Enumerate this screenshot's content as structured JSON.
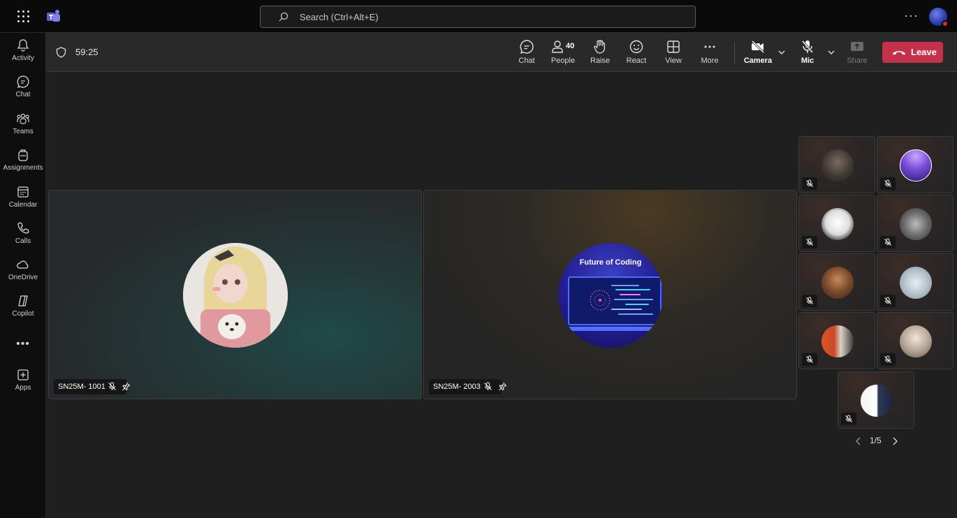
{
  "app": {
    "search_placeholder": "Search (Ctrl+Alt+E)",
    "more_icon": "more-horizontal-icon",
    "accent_color": "#c4314b"
  },
  "rail": {
    "items": [
      {
        "label": "Activity",
        "icon": "bell-icon"
      },
      {
        "label": "Chat",
        "icon": "chat-icon"
      },
      {
        "label": "Teams",
        "icon": "teams-icon"
      },
      {
        "label": "Assignments",
        "icon": "backpack-icon"
      },
      {
        "label": "Calendar",
        "icon": "calendar-icon"
      },
      {
        "label": "Calls",
        "icon": "phone-icon"
      },
      {
        "label": "OneDrive",
        "icon": "cloud-icon"
      },
      {
        "label": "Copilot",
        "icon": "copilot-icon"
      },
      {
        "label": "Apps",
        "icon": "add-app-icon"
      }
    ]
  },
  "meeting": {
    "timer": "59:25",
    "people_count": "40",
    "controls": {
      "chat": "Chat",
      "people": "People",
      "raise": "Raise",
      "react": "React",
      "view": "View",
      "more": "More",
      "camera": "Camera",
      "mic": "Mic",
      "share": "Share",
      "leave": "Leave"
    }
  },
  "participants": {
    "main": [
      {
        "name": "SN25M- 1001",
        "muted": true
      },
      {
        "name": "SN25M- 2003",
        "muted": true,
        "avatar_text": "Future of Coding"
      }
    ],
    "gallery_count": 9
  },
  "pagination": {
    "label": "1/5"
  }
}
